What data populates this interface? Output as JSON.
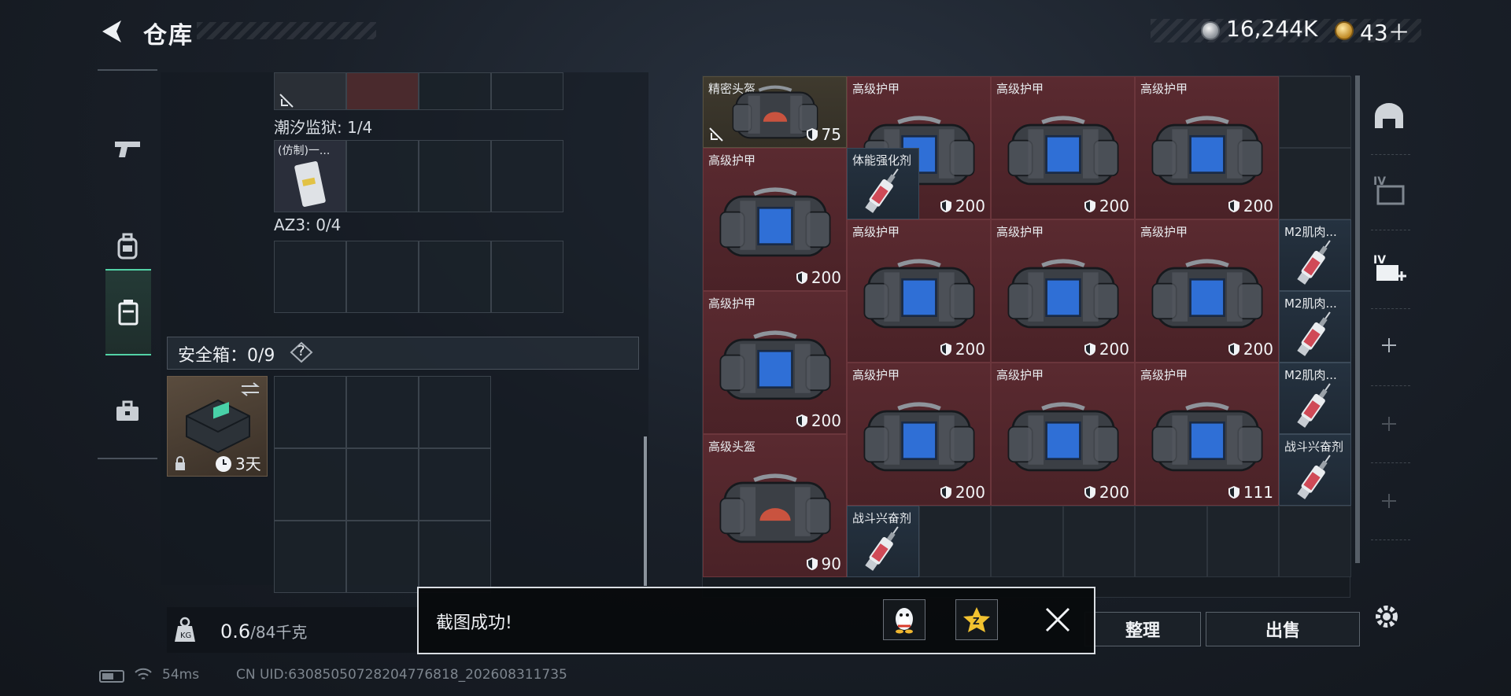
{
  "header": {
    "title": "仓库",
    "money": "16,244K",
    "gold": "43＋"
  },
  "left": {
    "sections": [
      {
        "label": "潮汐监狱: 1/4",
        "item_name": "(仿制)一..."
      },
      {
        "label": "AZ3: 0/4"
      }
    ],
    "safebox": {
      "label": "安全箱：0/9",
      "help": "?",
      "timer": "3天"
    },
    "weight": {
      "current": "0.6",
      "capacity": "/84千克"
    }
  },
  "stash": {
    "items": [
      {
        "name": "精密头盔",
        "durability": "75",
        "color": "olive",
        "kind": "helmet"
      },
      {
        "name": "高级护甲",
        "durability": "200",
        "color": "red",
        "kind": "armor"
      },
      {
        "name": "高级护甲",
        "durability": "200",
        "color": "red",
        "kind": "armor"
      },
      {
        "name": "高级护甲",
        "durability": "200",
        "color": "red",
        "kind": "armor"
      },
      {
        "name": "高级护甲",
        "durability": "200",
        "color": "red",
        "kind": "armor"
      },
      {
        "name": "体能强化剂",
        "color": "blue",
        "kind": "syringe"
      },
      {
        "name": "高级护甲",
        "durability": "200",
        "color": "red",
        "kind": "armor"
      },
      {
        "name": "高级护甲",
        "durability": "200",
        "color": "red",
        "kind": "armor"
      },
      {
        "name": "高级护甲",
        "durability": "200",
        "color": "red",
        "kind": "armor"
      },
      {
        "name": "M2肌肉...",
        "color": "blue",
        "kind": "syringe"
      },
      {
        "name": "高级护甲",
        "durability": "200",
        "color": "red",
        "kind": "armor"
      },
      {
        "name": "M2肌肉...",
        "color": "blue",
        "kind": "syringe"
      },
      {
        "name": "高级护甲",
        "durability": "200",
        "color": "red",
        "kind": "armor"
      },
      {
        "name": "高级护甲",
        "durability": "200",
        "color": "red",
        "kind": "armor"
      },
      {
        "name": "高级护甲",
        "durability": "111",
        "color": "red",
        "kind": "armor"
      },
      {
        "name": "M2肌肉...",
        "color": "blue",
        "kind": "syringe"
      },
      {
        "name": "高级头盔",
        "durability": "90",
        "color": "red",
        "kind": "helmet"
      },
      {
        "name": "战斗兴奋剂",
        "color": "blue",
        "kind": "syringe"
      },
      {
        "name": "战斗兴奋剂",
        "color": "blue",
        "kind": "syringe"
      }
    ]
  },
  "buttons": {
    "sort": "整理",
    "sell": "出售"
  },
  "toast": {
    "message": "截图成功!"
  },
  "status": {
    "ping": "54ms",
    "uid": "CN UID:63085050728204776818_202608311735"
  },
  "colors": {
    "accent": "#53d2a6",
    "red_slot": "#5a2a30",
    "blue_slot": "#253240",
    "olive_slot": "#3f3a2e"
  }
}
